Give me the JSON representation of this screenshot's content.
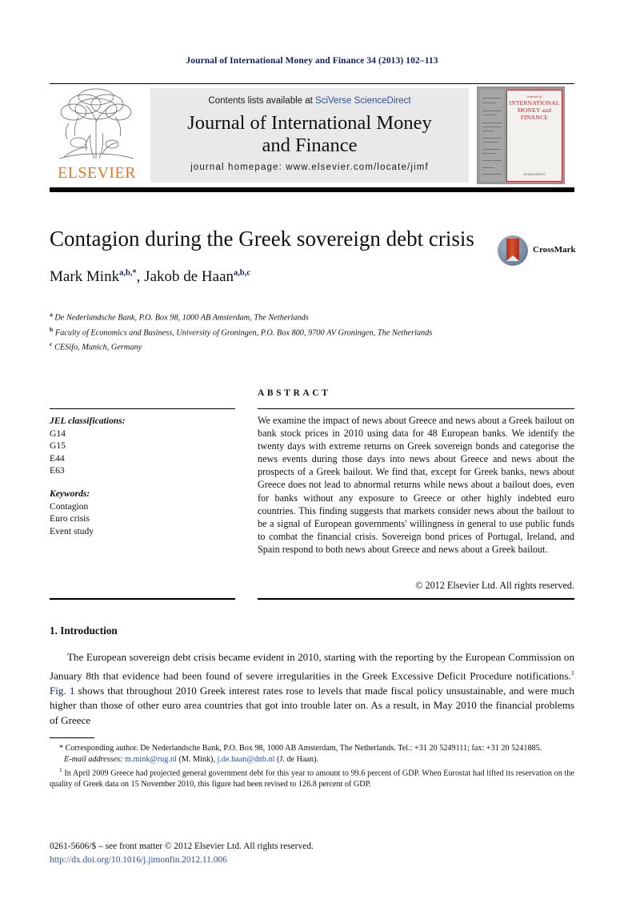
{
  "running_head": "Journal of International Money and Finance 34 (2013) 102–113",
  "banner": {
    "contents_prefix": "Contents lists available at ",
    "sciencedirect_link": "SciVerse ScienceDirect",
    "journal_title_line1": "Journal of International Money",
    "journal_title_line2": "and Finance",
    "homepage": "journal homepage: www.elsevier.com/locate/jimf",
    "publisher_wordmark": "ELSEVIER",
    "cover": {
      "small_title": "Journal of",
      "title": "INTERNATIONAL MONEY and FINANCE",
      "footer": "ScienceDirect"
    }
  },
  "article": {
    "title": "Contagion during the Greek sovereign debt crisis",
    "authors_plain": "Mark Mink a,b,*, Jakob de Haan a,b,c",
    "author1_name": "Mark Mink",
    "author1_sup": "a,b,*",
    "author_separator": ", ",
    "author2_name": "Jakob de Haan",
    "author2_sup": "a,b,c",
    "affiliations": [
      {
        "marker": "a",
        "text": "De Nederlandsche Bank, P.O. Box 98, 1000 AB Amsterdam, The Netherlands"
      },
      {
        "marker": "b",
        "text": "Faculty of Economics and Business, University of Groningen, P.O. Box 800, 9700 AV Groningen, The Netherlands"
      },
      {
        "marker": "c",
        "text": "CESifo, Munich, Germany"
      }
    ],
    "crossmark_label": "CrossMark"
  },
  "info_panel": {
    "jel_heading": "JEL classifications:",
    "jel_codes": "G14\nG15\nE44\nE63",
    "keywords_heading": "Keywords:",
    "keywords": "Contagion\nEuro crisis\nEvent study"
  },
  "abstract": {
    "heading": "ABSTRACT",
    "text": "We examine the impact of news about Greece and news about a Greek bailout on bank stock prices in 2010 using data for 48 European banks. We identify the twenty days with extreme returns on Greek sovereign bonds and categorise the news events during those days into news about Greece and news about the prospects of a Greek bailout. We find that, except for Greek banks, news about Greece does not lead to abnormal returns while news about a bailout does, even for banks without any exposure to Greece or other highly indebted euro countries. This finding suggests that markets consider news about the bailout to be a signal of European governments' willingness in general to use public funds to combat the financial crisis. Sovereign bond prices of Portugal, Ireland, and Spain respond to both news about Greece and news about a Greek bailout.",
    "copyright": "© 2012 Elsevier Ltd. All rights reserved."
  },
  "body": {
    "section_heading": "1. Introduction",
    "paragraph_part1": "The European sovereign debt crisis became evident in 2010, starting with the reporting by the European Commission on January 8th that evidence had been found of severe irregularities in the Greek Excessive Deficit Procedure notifications.",
    "footnote_marker": "1",
    "figure_link": "Fig. 1",
    "paragraph_part2": " shows that throughout 2010 Greek interest rates rose to levels that made fiscal policy unsustainable, and were much higher than those of other euro area countries that got into trouble later on. As a result, in May 2010 the financial problems of Greece"
  },
  "footnotes": {
    "corresponding_marker": "*",
    "corresponding": "Corresponding author. De Nederlandsche Bank, P.O. Box 98, 1000 AB Amsterdam, The Netherlands. Tel.: +31 20 5249111; fax: +31 20 5241885.",
    "email_label": "E-mail addresses:",
    "email1": "m.mink@rug.nl",
    "email1_owner": " (M. Mink), ",
    "email2": "j.de.haan@dnb.nl",
    "email2_owner": " (J. de Haan).",
    "note1_marker": "1",
    "note1": "In April 2009 Greece had projected general government debt for this year to amount to 99.6 percent of GDP. When Eurostat had lifted its reservation on the quality of Greek data on 15 November 2010, this figure had been revised to 126.8 percent of GDP."
  },
  "bottom": {
    "issn_line": "0261-5606/$ – see front matter © 2012 Elsevier Ltd. All rights reserved.",
    "doi": "http://dx.doi.org/10.1016/j.jimonfin.2012.11.006"
  },
  "colors": {
    "link_blue": "#2b4fa2",
    "navy": "#13205e",
    "elsevier_orange": "#e87722",
    "banner_grey": "#e9e9e9",
    "cover_red": "#b3262b"
  }
}
